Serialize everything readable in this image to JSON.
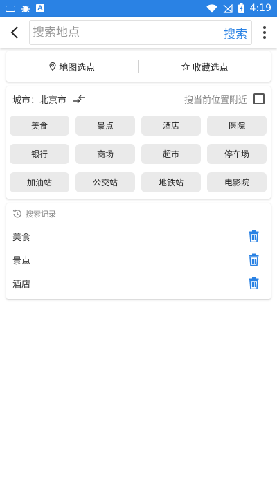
{
  "status_bar": {
    "app_icon_text": "A",
    "time": "4:19"
  },
  "toolbar": {
    "search_placeholder": "搜索地点",
    "search_label": "搜索"
  },
  "pick": {
    "map_pick_label": "地图选点",
    "fav_pick_label": "收藏选点"
  },
  "city": {
    "label": "城市：北京市",
    "nearby_label": "搜当前位置附近",
    "nearby_checked": false
  },
  "categories": [
    "美食",
    "景点",
    "酒店",
    "医院",
    "银行",
    "商场",
    "超市",
    "停车场",
    "加油站",
    "公交站",
    "地铁站",
    "电影院"
  ],
  "history": {
    "title": "搜索记录",
    "items": [
      "美食",
      "景点",
      "酒店"
    ]
  },
  "colors": {
    "accent": "#2a82e4",
    "status_bar": "#2a82e4"
  },
  "icons": {
    "back": "chevron-left-icon",
    "more": "more-vertical-icon",
    "map_pin": "map-pin-icon",
    "star": "star-outline-icon",
    "switch": "switch-arrows-icon",
    "history": "history-icon",
    "delete": "trash-icon"
  }
}
